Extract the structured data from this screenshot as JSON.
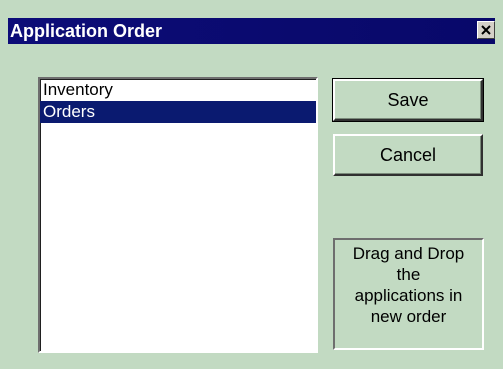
{
  "window": {
    "title": "Application Order",
    "close_icon": "close-icon"
  },
  "list": {
    "items": [
      {
        "label": "Inventory",
        "selected": false
      },
      {
        "label": "Orders",
        "selected": true
      }
    ]
  },
  "buttons": {
    "save_label": "Save",
    "cancel_label": "Cancel"
  },
  "hint": {
    "lines": [
      "Drag and Drop",
      "the",
      "applications in",
      "new order"
    ]
  },
  "colors": {
    "titlebar": "#0a0a6e",
    "window_bg": "#c2dac2",
    "selection": "#0a1a70"
  }
}
